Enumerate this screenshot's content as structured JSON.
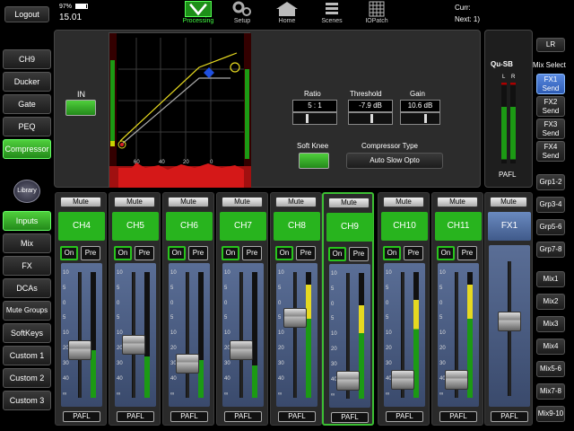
{
  "top": {
    "logout": "Logout",
    "battery": "97%",
    "time": "15.01",
    "curr_label": "Curr:",
    "next_label": "Next:",
    "next_value": "1)",
    "tabs": [
      "Processing",
      "Setup",
      "Home",
      "Scenes",
      "IOPatch"
    ]
  },
  "left_proc": [
    "CH9",
    "Ducker",
    "Gate",
    "PEQ",
    "Compressor"
  ],
  "library": "Library",
  "left_layers": [
    "Inputs",
    "Mix",
    "FX",
    "DCAs",
    "Mute Groups",
    "SoftKeys",
    "Custom 1",
    "Custom 2",
    "Custom 3"
  ],
  "comp": {
    "in_label": "IN",
    "graph_ticks": [
      "60",
      "40",
      "20",
      "0"
    ],
    "ratio_label": "Ratio",
    "ratio_value": "5 : 1",
    "ratio_level": 0.33,
    "threshold_label": "Threshold",
    "threshold_value": "-7.9 dB",
    "threshold_level": 0.55,
    "gain_label": "Gain",
    "gain_value": "10.6 dB",
    "gain_level": 0.68,
    "softknee_label": "Soft Knee",
    "type_label": "Compressor Type",
    "type_value": "Auto Slow Opto"
  },
  "right": {
    "lr": "LR",
    "mix_select": "Mix Select",
    "model": "Qu-SB",
    "meter_l": "L",
    "meter_r": "R",
    "pafl": "PAFL",
    "sends": [
      "FX1 Send",
      "FX2 Send",
      "FX3 Send",
      "FX4 Send"
    ],
    "groups": [
      "Grp1-2",
      "Grp3-4",
      "Grp5-6",
      "Grp7-8"
    ],
    "mixes": [
      "Mix1",
      "Mix2",
      "Mix3",
      "Mix4",
      "Mix5-6",
      "Mix7-8",
      "Mix9-10"
    ]
  },
  "master": {
    "mute": "Mute",
    "name": "FX1",
    "pafl": "PAFL",
    "level": 0.56
  },
  "strip_labels": {
    "mute": "Mute",
    "on": "On",
    "pre": "Pre",
    "pafl": "PAFL"
  },
  "fader_scale": [
    "10",
    "5",
    "0",
    "5",
    "10",
    "20",
    "30",
    "40",
    "∞"
  ],
  "channels": [
    {
      "name": "CH4",
      "level": 0.36,
      "meter": 0.38
    },
    {
      "name": "CH5",
      "level": 0.41,
      "meter": 0.33
    },
    {
      "name": "CH6",
      "level": 0.23,
      "meter": 0.3
    },
    {
      "name": "CH7",
      "level": 0.36,
      "meter": 0.26
    },
    {
      "name": "CH8",
      "level": 0.66,
      "meter": 0.9
    },
    {
      "name": "CH9",
      "level": 0.08,
      "meter": 0.74
    },
    {
      "name": "CH10",
      "level": 0.08,
      "meter": 0.78
    },
    {
      "name": "CH11",
      "level": 0.08,
      "meter": 0.9
    }
  ]
}
